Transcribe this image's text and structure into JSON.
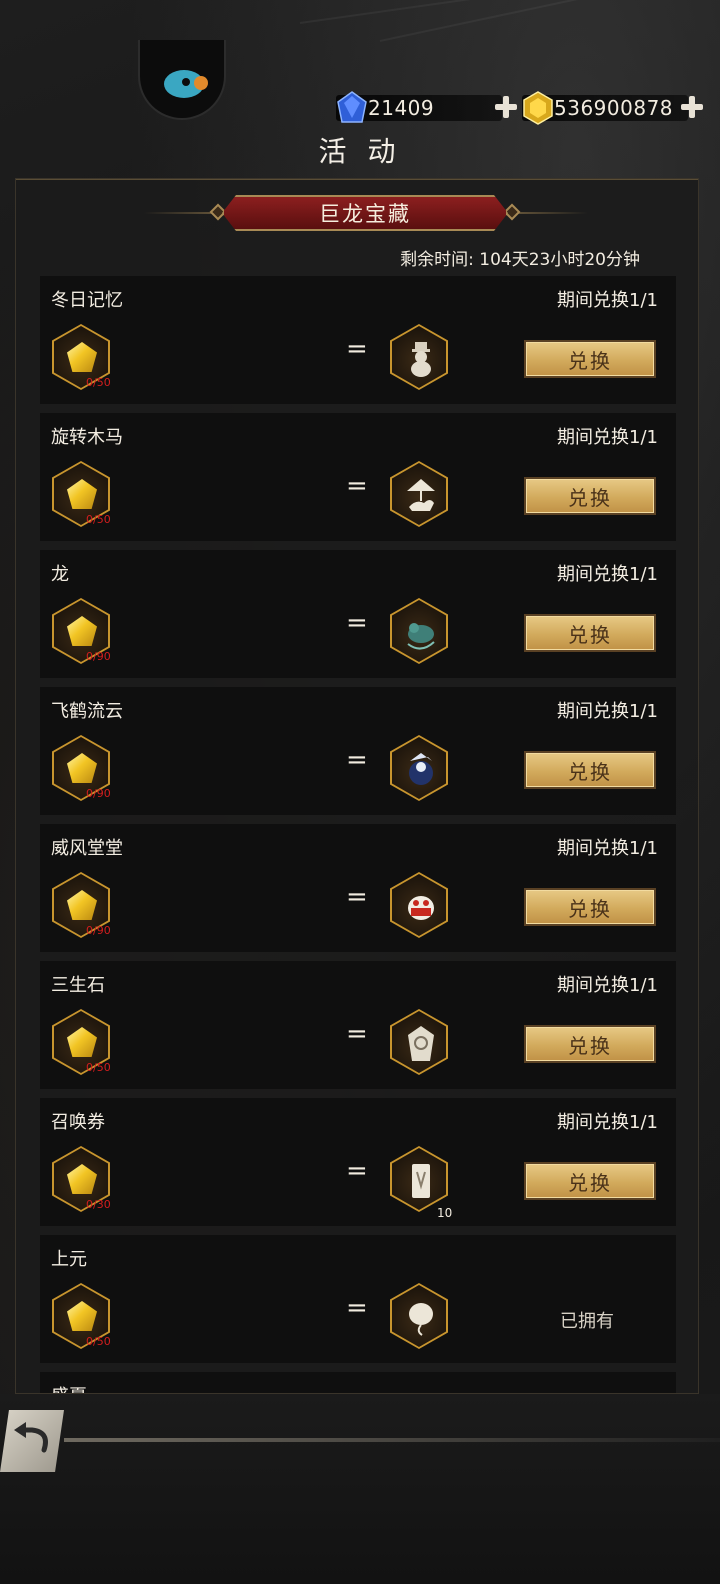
{
  "header": {
    "title": "活 动",
    "currencies": [
      {
        "name": "diamond",
        "value": "21409",
        "icon": "blue-gem-icon",
        "color": "#3a6fe0"
      },
      {
        "name": "gold",
        "value": "536900878",
        "icon": "gold-gem-icon",
        "color": "#f0c020"
      }
    ]
  },
  "event": {
    "title": "巨龙宝藏",
    "remaining_label": "剩余时间: 104天23小时20分钟"
  },
  "items": [
    {
      "name": "冬日记忆",
      "limit": "期间兑换1/1",
      "cost": "0/50",
      "reward_icon": "snowman-statue-icon",
      "action": "兑换"
    },
    {
      "name": "旋转木马",
      "limit": "期间兑换1/1",
      "cost": "0/50",
      "reward_icon": "carousel-horse-icon",
      "action": "兑换"
    },
    {
      "name": "龙",
      "limit": "期间兑换1/1",
      "cost": "0/90",
      "reward_icon": "dragon-icon",
      "action": "兑换"
    },
    {
      "name": "飞鹤流云",
      "limit": "期间兑换1/1",
      "cost": "0/90",
      "reward_icon": "crane-cloud-icon",
      "action": "兑换"
    },
    {
      "name": "威风堂堂",
      "limit": "期间兑换1/1",
      "cost": "0/90",
      "reward_icon": "lion-dance-icon",
      "action": "兑换"
    },
    {
      "name": "三生石",
      "limit": "期间兑换1/1",
      "cost": "0/50",
      "reward_icon": "stone-tablet-icon",
      "action": "兑换"
    },
    {
      "name": "召唤券",
      "limit": "期间兑换1/1",
      "cost": "0/30",
      "reward_icon": "summon-ticket-icon",
      "quantity": "10",
      "action": "兑换"
    },
    {
      "name": "上元",
      "limit": "",
      "cost": "0/50",
      "reward_icon": "lantern-icon",
      "status": "已拥有"
    },
    {
      "name": "盛夏"
    }
  ]
}
